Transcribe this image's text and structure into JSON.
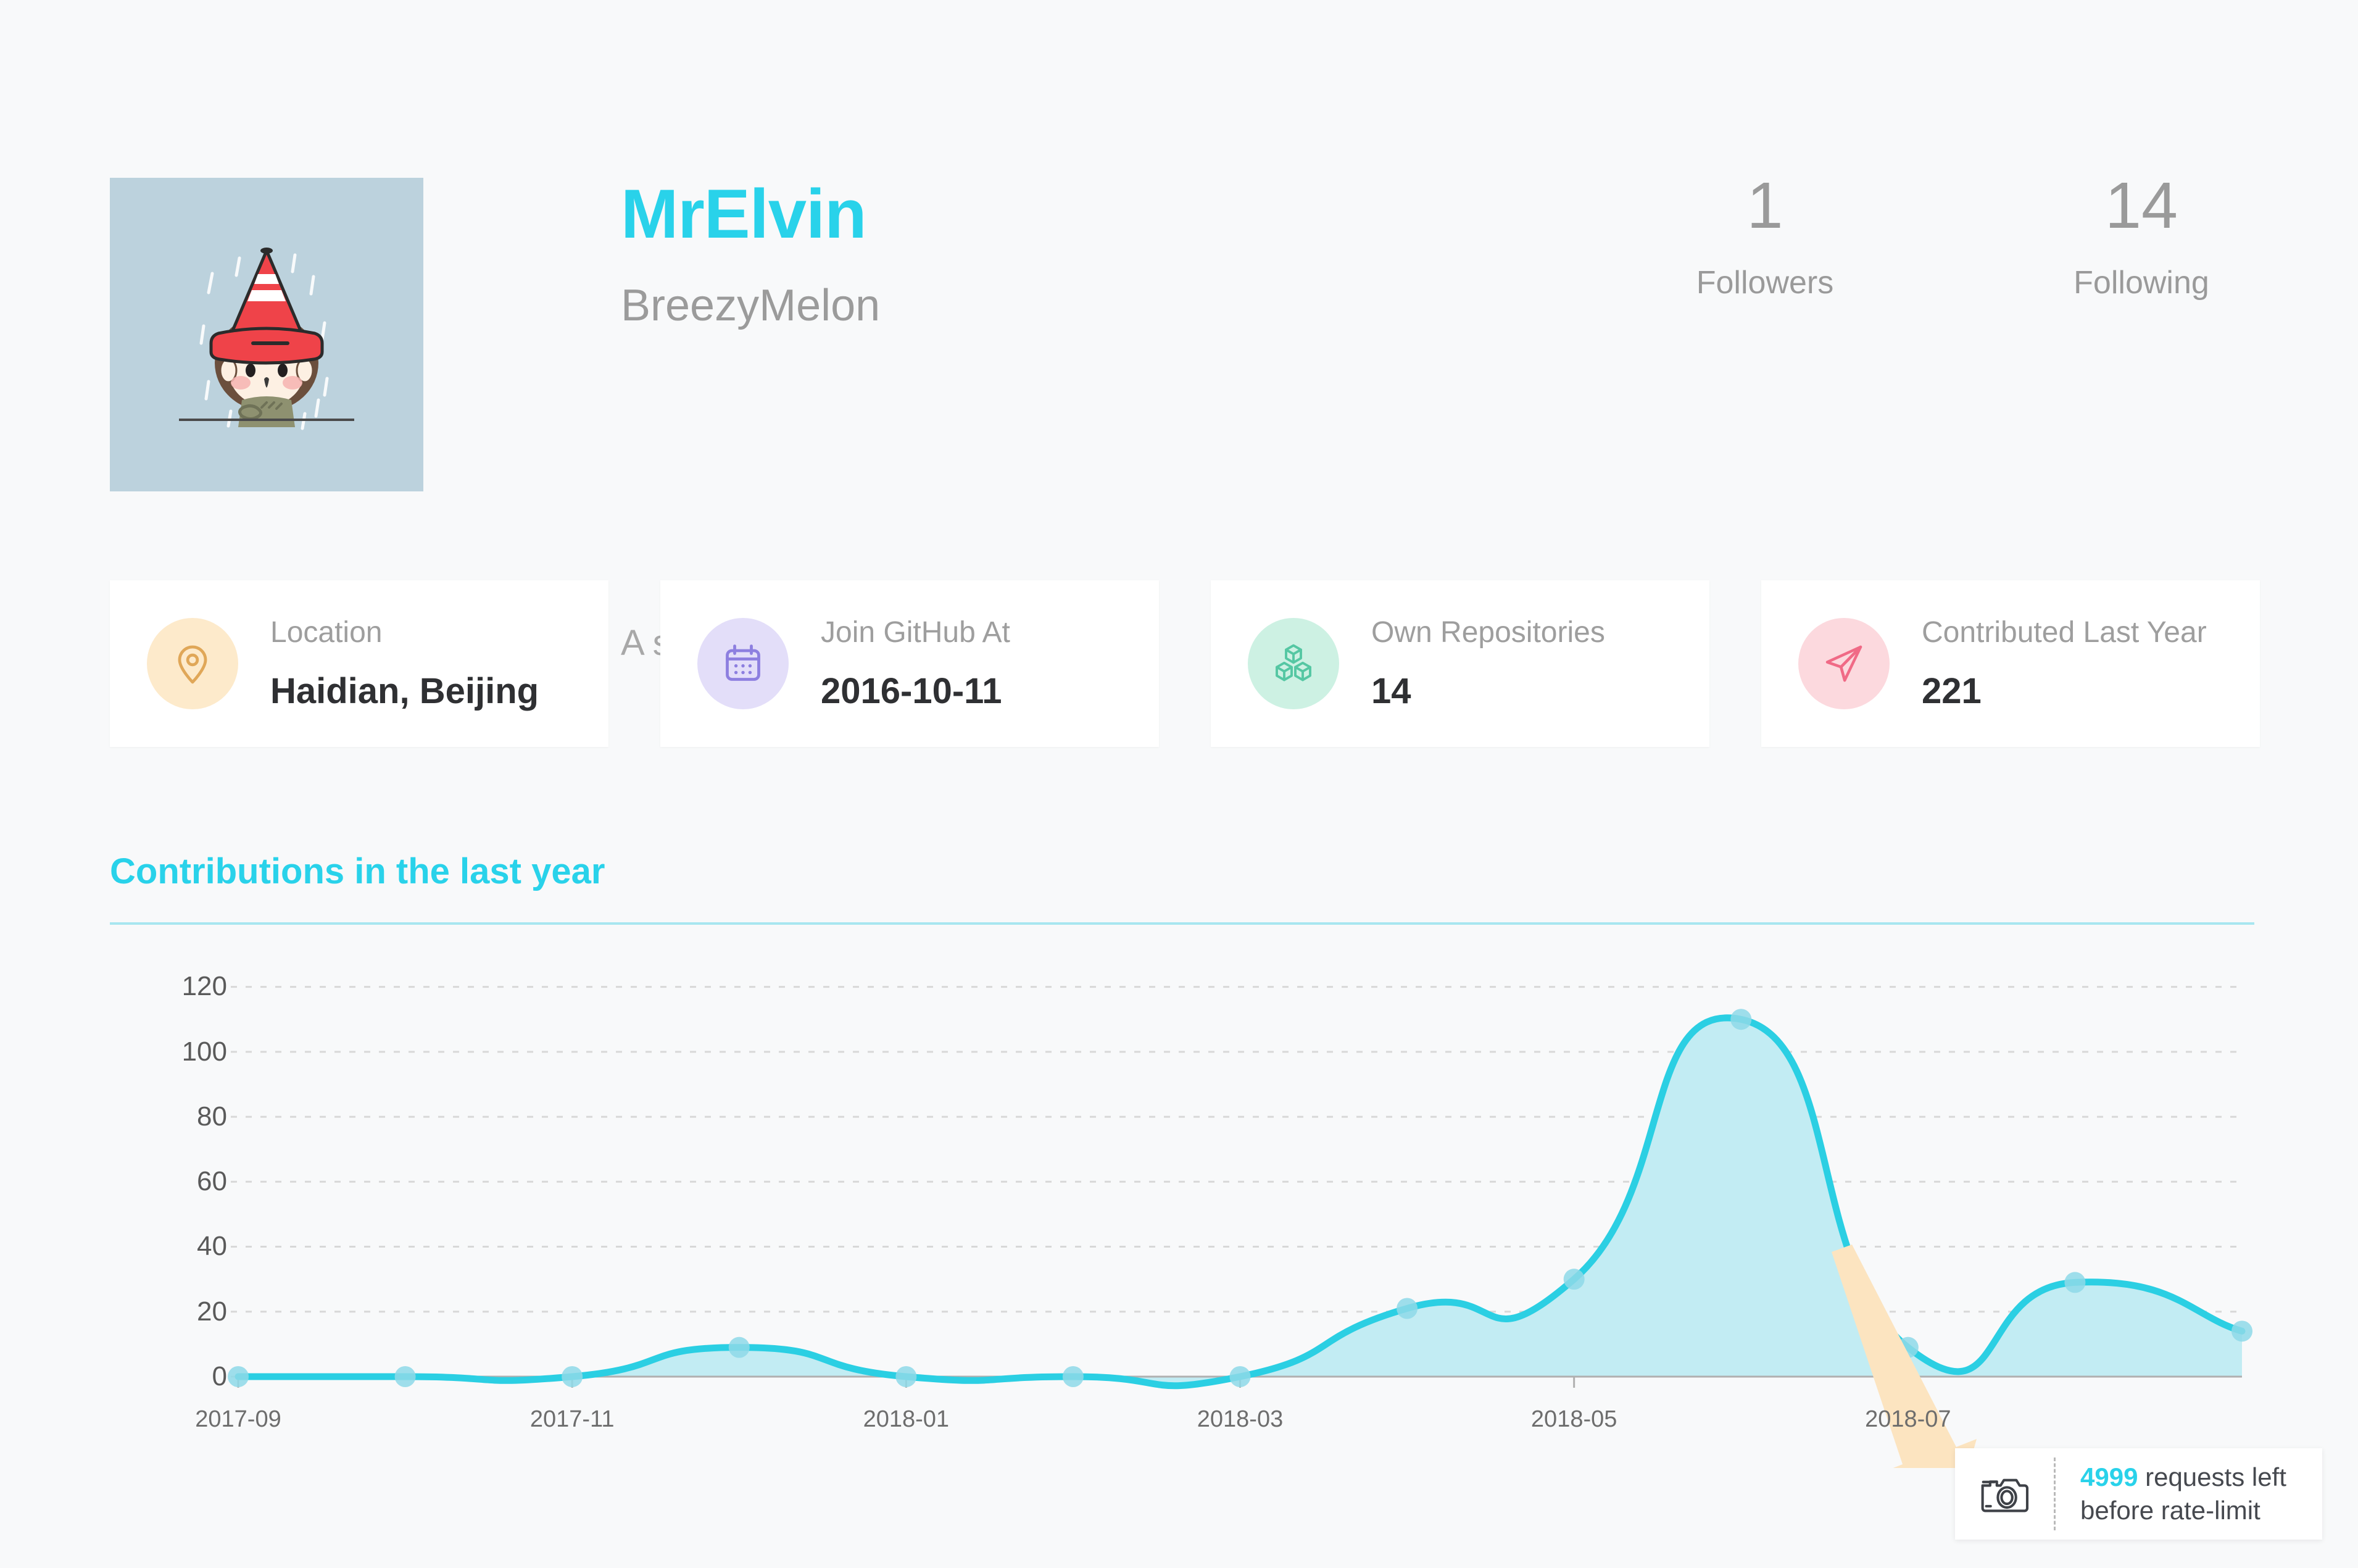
{
  "profile": {
    "username": "MrElvin",
    "nickname": "BreezyMelon",
    "bio": "A student in BUPT. Love frontend.",
    "avatar_alt": "boy-with-traffic-cone-hat-avatar",
    "stats": [
      {
        "value": "1",
        "label": "Followers"
      },
      {
        "value": "14",
        "label": "Following"
      }
    ]
  },
  "cards": [
    {
      "icon": "location-pin-icon",
      "title": "Location",
      "value": "Haidian, Beijing",
      "bg": "#fdeacb",
      "fg": "#e0a758"
    },
    {
      "icon": "calendar-icon",
      "title": "Join GitHub At",
      "value": "2016-10-11",
      "bg": "#e3def9",
      "fg": "#8d7fe0"
    },
    {
      "icon": "cubes-icon",
      "title": "Own Repositories",
      "value": "14",
      "bg": "#cdf1e3",
      "fg": "#55c7a3"
    },
    {
      "icon": "paper-plane-icon",
      "title": "Contributed Last Year",
      "value": "221",
      "bg": "#fcd9de",
      "fg": "#f06a86"
    }
  ],
  "chart_section": {
    "heading": "Contributions in the last year",
    "accent": "#29d2ea"
  },
  "chart_data": {
    "type": "area",
    "title": "Contributions in the last year",
    "xlabel": "",
    "ylabel": "",
    "grid": true,
    "legend": "none",
    "line_color": "#2bcfe3",
    "fill_color": "#c2ecf3",
    "point_color": "#8ed9e8",
    "ylim": [
      0,
      130
    ],
    "yticks": [
      0,
      20,
      40,
      60,
      80,
      100,
      120
    ],
    "ytick_labels": [
      "0",
      "20",
      "40",
      "60",
      "80",
      "100",
      "120"
    ],
    "xtick_labels": [
      "2017-09",
      "2017-11",
      "2018-01",
      "2018-03",
      "2018-05",
      "2018-07"
    ],
    "x": [
      "2017-09",
      "2017-10",
      "2017-11",
      "2017-12",
      "2018-01",
      "2018-02",
      "2018-03",
      "2018-04",
      "2018-05",
      "2018-06",
      "2018-07",
      "2018-08",
      "2018-09"
    ],
    "values": [
      0,
      0,
      0,
      9,
      0,
      0,
      0,
      21,
      30,
      110,
      9,
      29,
      14
    ],
    "series": [
      {
        "name": "Contributions",
        "values": [
          0,
          0,
          0,
          9,
          0,
          0,
          0,
          21,
          30,
          110,
          9,
          29,
          14
        ]
      }
    ],
    "annotation": {
      "type": "arrow-cursor",
      "color": "#fce4c0"
    }
  },
  "rate_limit": {
    "icon": "camera-icon",
    "count": "4999",
    "text_rest": " requests left",
    "line2": "before rate-limit"
  }
}
